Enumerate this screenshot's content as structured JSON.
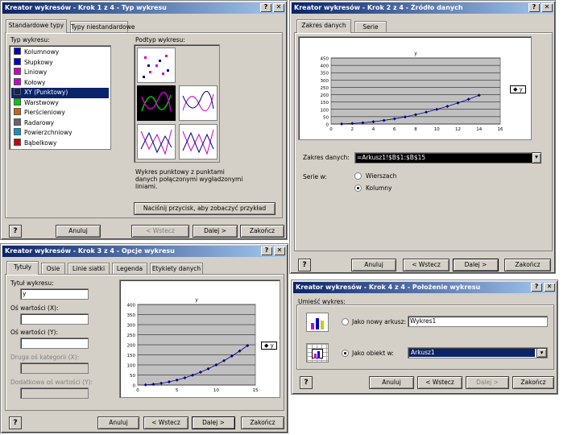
{
  "step1": {
    "title": "Kreator wykresów - Krok 1 z 4 - Typ wykresu",
    "tabs": [
      "Standardowe typy",
      "Typy niestandardowe"
    ],
    "type_label": "Typ wykresu:",
    "subtype_label": "Podtyp wykresu:",
    "types": [
      "Kolumnowy",
      "Słupkowy",
      "Liniowy",
      "Kołowy",
      "XY (Punktowy)",
      "Warstwowy",
      "Pierścieniowy",
      "Radarowy",
      "Powierzchniowy",
      "Bąbelkowy"
    ],
    "selected_type": "XY (Punktowy)",
    "description": "Wykres punktowy z punktami danych połączonymi wygładzonymi liniami.",
    "preview_button": "Naciśnij przycisk, aby zobaczyć przykład",
    "buttons": {
      "cancel": "Anuluj",
      "back": "< Wstecz",
      "next": "Dalej >",
      "finish": "Zakończ"
    }
  },
  "step2": {
    "title": "Kreator wykresów - Krok 2 z 4 - Źródło danych",
    "tabs": [
      "Zakres danych",
      "Serie"
    ],
    "chart_title": "y",
    "legend": "y",
    "range_label": "Zakres danych:",
    "range_value": "=Arkusz1!$B$1:$B$15",
    "series_label": "Serie w:",
    "opt_rows": "Wierszach",
    "opt_cols": "Kolumny",
    "buttons": {
      "cancel": "Anuluj",
      "back": "< Wstecz",
      "next": "Dalej >",
      "finish": "Zakończ"
    }
  },
  "step3": {
    "title": "Kreator wykresów - Krok 3 z 4 - Opcje wykresu",
    "tabs": [
      "Tytuły",
      "Osie",
      "Linie siatki",
      "Legenda",
      "Etykiety danych"
    ],
    "chart_title_label": "Tytuł wykresu:",
    "chart_title_value": "y",
    "x_label": "Oś wartości (X):",
    "y_label": "Oś wartości (Y):",
    "x2_label": "Druga oś kategorii (X):",
    "y2_label": "Dodatkowa oś wartości (Y):",
    "chart_title": "y",
    "legend": "y",
    "buttons": {
      "cancel": "Anuluj",
      "back": "< Wstecz",
      "next": "Dalej >",
      "finish": "Zakończ"
    }
  },
  "step4": {
    "title": "Kreator wykresów - Krok 4 z 4 - Położenie wykresu",
    "place_label": "Umieść wykres:",
    "opt_new": "Jako nowy arkusz:",
    "new_value": "Wykres1",
    "opt_obj": "Jako obiekt w:",
    "obj_value": "Arkusz1",
    "buttons": {
      "cancel": "Anuluj",
      "back": "< Wstecz",
      "next": "Dalej >",
      "finish": "Zakończ"
    }
  },
  "chart_data": [
    {
      "type": "scatter",
      "title": "y",
      "series": [
        {
          "name": "y",
          "x": [
            1,
            2,
            3,
            4,
            5,
            6,
            7,
            8,
            9,
            10,
            11,
            12,
            13,
            14
          ],
          "y": [
            1,
            4,
            9,
            16,
            25,
            36,
            49,
            64,
            81,
            100,
            121,
            144,
            169,
            196
          ]
        }
      ],
      "xlim": [
        0,
        16
      ],
      "ylim": [
        0,
        450
      ],
      "xticks": [
        "0",
        "2",
        "4",
        "6",
        "8",
        "10",
        "12",
        "14",
        "16"
      ],
      "yticks": [
        "0",
        "50",
        "100",
        "150",
        "200",
        "250",
        "300",
        "350",
        "400",
        "450"
      ],
      "grid": true,
      "legend": "right"
    },
    {
      "type": "scatter",
      "title": "y",
      "series": [
        {
          "name": "y",
          "x": [
            1,
            2,
            3,
            4,
            5,
            6,
            7,
            8,
            9,
            10,
            11,
            12,
            13,
            14
          ],
          "y": [
            1,
            4,
            9,
            16,
            25,
            36,
            49,
            64,
            81,
            100,
            121,
            144,
            169,
            196
          ]
        }
      ],
      "xlim": [
        0,
        15
      ],
      "ylim": [
        0,
        400
      ],
      "xticks": [
        "0",
        "5",
        "10",
        "15"
      ],
      "yticks": [
        "0",
        "50",
        "100",
        "150",
        "200",
        "250",
        "300",
        "350",
        "400"
      ],
      "grid": true,
      "legend": "right"
    }
  ]
}
